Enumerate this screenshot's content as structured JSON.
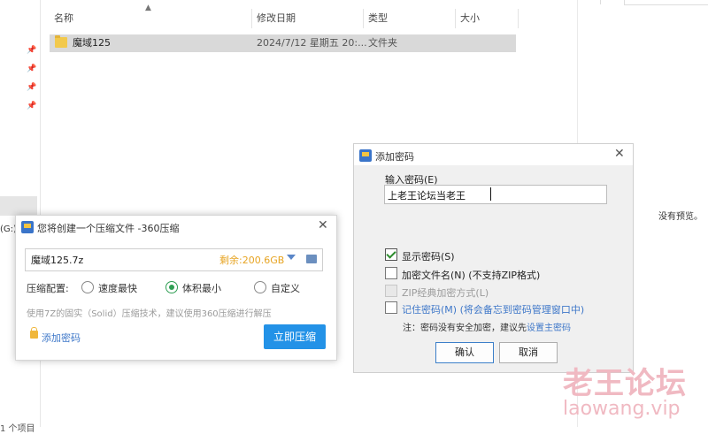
{
  "explorer": {
    "columns": {
      "name": "名称",
      "modified": "修改日期",
      "type": "类型",
      "size": "大小"
    },
    "rows": [
      {
        "name": "魔域125",
        "modified": "2024/7/12 星期五 20:...",
        "type": "文件夹",
        "size": ""
      }
    ],
    "drive_label": "(G:)",
    "item_count": "1 个项目",
    "no_preview": "没有预览。"
  },
  "compress_dialog": {
    "title": "您将创建一个压缩文件 -360压缩",
    "filename": "魔域125.7z",
    "free_space": "剩余:200.6GB",
    "config_label": "压缩配置:",
    "options": [
      {
        "label": "速度最快",
        "selected": false
      },
      {
        "label": "体积最小",
        "selected": true
      },
      {
        "label": "自定义",
        "selected": false
      }
    ],
    "hint": "使用7Z的固实（Solid）压缩技术，建议使用360压缩进行解压",
    "add_password": "添加密码",
    "compress_now": "立即压缩"
  },
  "password_dialog": {
    "title": "添加密码",
    "input_label": "输入密码(E)",
    "password_value": "上老王论坛当老王",
    "show_password": {
      "label": "显示密码(S)",
      "checked": true
    },
    "encrypt_names": {
      "label": "加密文件名(N) (不支持ZIP格式)",
      "checked": false
    },
    "zip_classic": {
      "label": "ZIP经典加密方式(L)",
      "checked": false,
      "disabled": true
    },
    "remember": {
      "label": "记住密码(M)",
      "note": "(将会备忘到密码管理窗口中)",
      "checked": false
    },
    "footer_note": "注：密码没有安全加密，建议先",
    "footer_link": "设置主密码",
    "ok": "确认",
    "cancel": "取消"
  },
  "watermark": {
    "title": "老王论坛",
    "url": "laowang.vip"
  }
}
